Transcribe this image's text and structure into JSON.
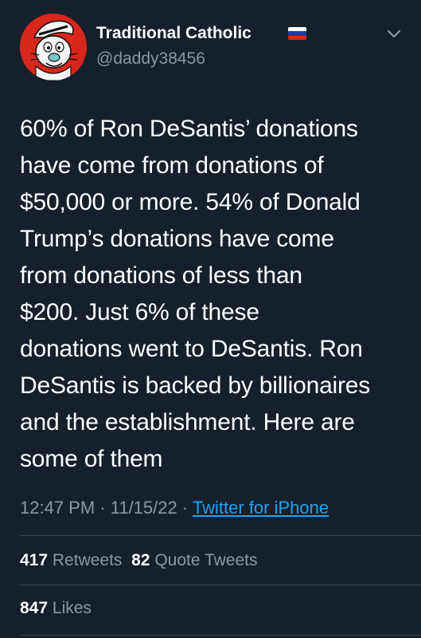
{
  "author": {
    "display_name": "Traditional Catholic",
    "handle": "@daddy38456",
    "avatar_icon": "cartoon-cat-avatar-icon",
    "flag_icon": "russian-flag-icon",
    "flag_colors": [
      "#ffffff",
      "#1c3fa8",
      "#d52b1e"
    ]
  },
  "tweet": {
    "text": "60% of Ron DeSantis’ donations\nhave come from donations of\n$50,000 or more. 54% of Donald\nTrump’s donations have come\nfrom donations of less than\n$200. Just 6% of these\ndonations went to DeSantis. Ron\nDeSantis is backed by billionaires\nand the establishment. Here are\nsome of them",
    "time": "12:47 PM",
    "separator_1": " · ",
    "date": "11/15/22",
    "separator_2": " · ",
    "source": "Twitter for iPhone"
  },
  "stats": {
    "retweets_count": "417",
    "retweets_label": "Retweets",
    "quote_tweets_count": "82",
    "quote_tweets_label": "Quote Tweets",
    "likes_count": "847",
    "likes_label": "Likes"
  },
  "colors": {
    "background": "#15202b",
    "secondary_text": "#8899a6",
    "link": "#1da1f2",
    "divider": "#38444d"
  }
}
